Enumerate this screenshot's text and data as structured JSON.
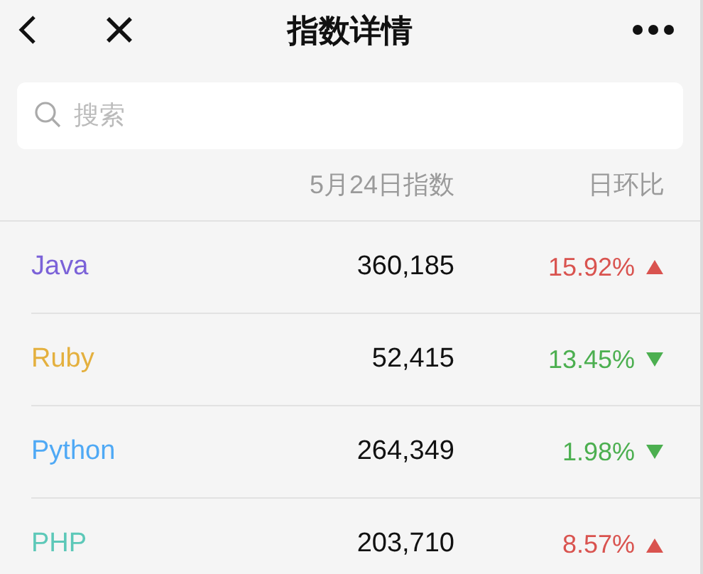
{
  "header": {
    "title": "指数详情"
  },
  "search": {
    "placeholder": "搜索"
  },
  "table": {
    "columns": [
      "5月24日指数",
      "日环比"
    ],
    "rows": [
      {
        "name": "Java",
        "color": "#7b62d8",
        "value": "360,185",
        "change": "15.92%",
        "kind": "up"
      },
      {
        "name": "Ruby",
        "color": "#e4b03e",
        "value": "52,415",
        "change": "13.45%",
        "kind": "down"
      },
      {
        "name": "Python",
        "color": "#4fa9f5",
        "value": "264,349",
        "change": "1.98%",
        "kind": "down"
      },
      {
        "name": "PHP",
        "color": "#5cc8b8",
        "value": "203,710",
        "change": "8.57%",
        "kind": "up"
      }
    ]
  }
}
